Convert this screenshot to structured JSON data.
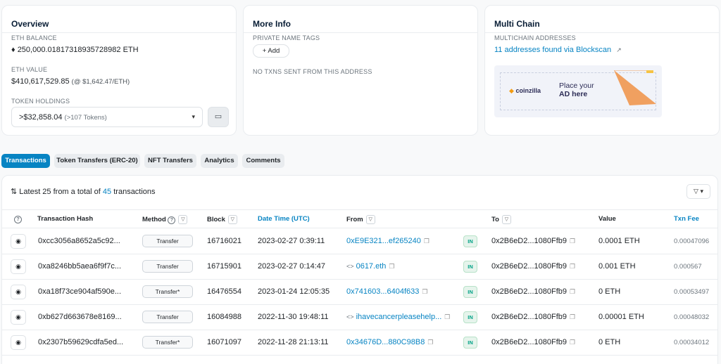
{
  "overview": {
    "title": "Overview",
    "eth_balance_label": "ETH BALANCE",
    "eth_balance": "250,000.01817318935728982 ETH",
    "eth_value_label": "ETH VALUE",
    "eth_value": "$410,617,529.85",
    "eth_price": "(@ $1,642.47/ETH)",
    "token_holdings_label": "TOKEN HOLDINGS",
    "token_value": ">$32,858.04",
    "token_count": "(>107 Tokens)"
  },
  "more_info": {
    "title": "More Info",
    "private_tags_label": "PRIVATE NAME TAGS",
    "add_label": "+ Add",
    "no_txns": "NO TXNS SENT FROM THIS ADDRESS"
  },
  "multi_chain": {
    "title": "Multi Chain",
    "addresses_label": "MULTICHAIN ADDRESSES",
    "addresses_link": "11 addresses found via Blockscan",
    "ad_brand": "coinzilla",
    "ad_text_line1": "Place your",
    "ad_text_line2": "AD here"
  },
  "tabs": [
    {
      "label": "Transactions"
    },
    {
      "label": "Token Transfers (ERC-20)"
    },
    {
      "label": "NFT Transfers"
    },
    {
      "label": "Analytics"
    },
    {
      "label": "Comments"
    }
  ],
  "table": {
    "summary_prefix": "Latest 25 from a total of",
    "summary_count": "45",
    "summary_suffix": "transactions",
    "columns": {
      "hash": "Transaction Hash",
      "method": "Method",
      "block": "Block",
      "datetime": "Date Time (UTC)",
      "from": "From",
      "to": "To",
      "value": "Value",
      "fee": "Txn Fee"
    },
    "rows": [
      {
        "hash": "0xcc3056a8652a5c92...",
        "method": "Transfer",
        "block": "16716021",
        "datetime": "2023-02-27 0:39:11",
        "from": "0xE9E321...ef265240",
        "from_icon": false,
        "dir": "IN",
        "to": "0x2B6eD2...1080Ffb9",
        "value": "0.0001 ETH",
        "fee": "0.00047096"
      },
      {
        "hash": "0xa8246bb5aea6f9f7c...",
        "method": "Transfer",
        "block": "16715901",
        "datetime": "2023-02-27 0:14:47",
        "from": "0617.eth",
        "from_icon": true,
        "dir": "IN",
        "to": "0x2B6eD2...1080Ffb9",
        "value": "0.001 ETH",
        "fee": "0.000567"
      },
      {
        "hash": "0xa18f73ce904af590e...",
        "method": "Transfer*",
        "block": "16476554",
        "datetime": "2023-01-24 12:05:35",
        "from": "0x741603...6404f633",
        "from_icon": false,
        "dir": "IN",
        "to": "0x2B6eD2...1080Ffb9",
        "value": "0 ETH",
        "fee": "0.00053497"
      },
      {
        "hash": "0xb627d663678e8169...",
        "method": "Transfer",
        "block": "16084988",
        "datetime": "2022-11-30 19:48:11",
        "from": "ihavecancerpleasehelp...",
        "from_icon": true,
        "dir": "IN",
        "to": "0x2B6eD2...1080Ffb9",
        "value": "0.00001 ETH",
        "fee": "0.00048032"
      },
      {
        "hash": "0x2307b59629cdfa5ed...",
        "method": "Transfer*",
        "block": "16071097",
        "datetime": "2022-11-28 21:13:11",
        "from": "0x34676D...880C98B8",
        "from_icon": false,
        "dir": "IN",
        "to": "0x2B6eD2...1080Ffb9",
        "value": "0 ETH",
        "fee": "0.00034012"
      }
    ]
  },
  "colors": {
    "accent": "#0784c3",
    "in_badge": "#00a186"
  }
}
